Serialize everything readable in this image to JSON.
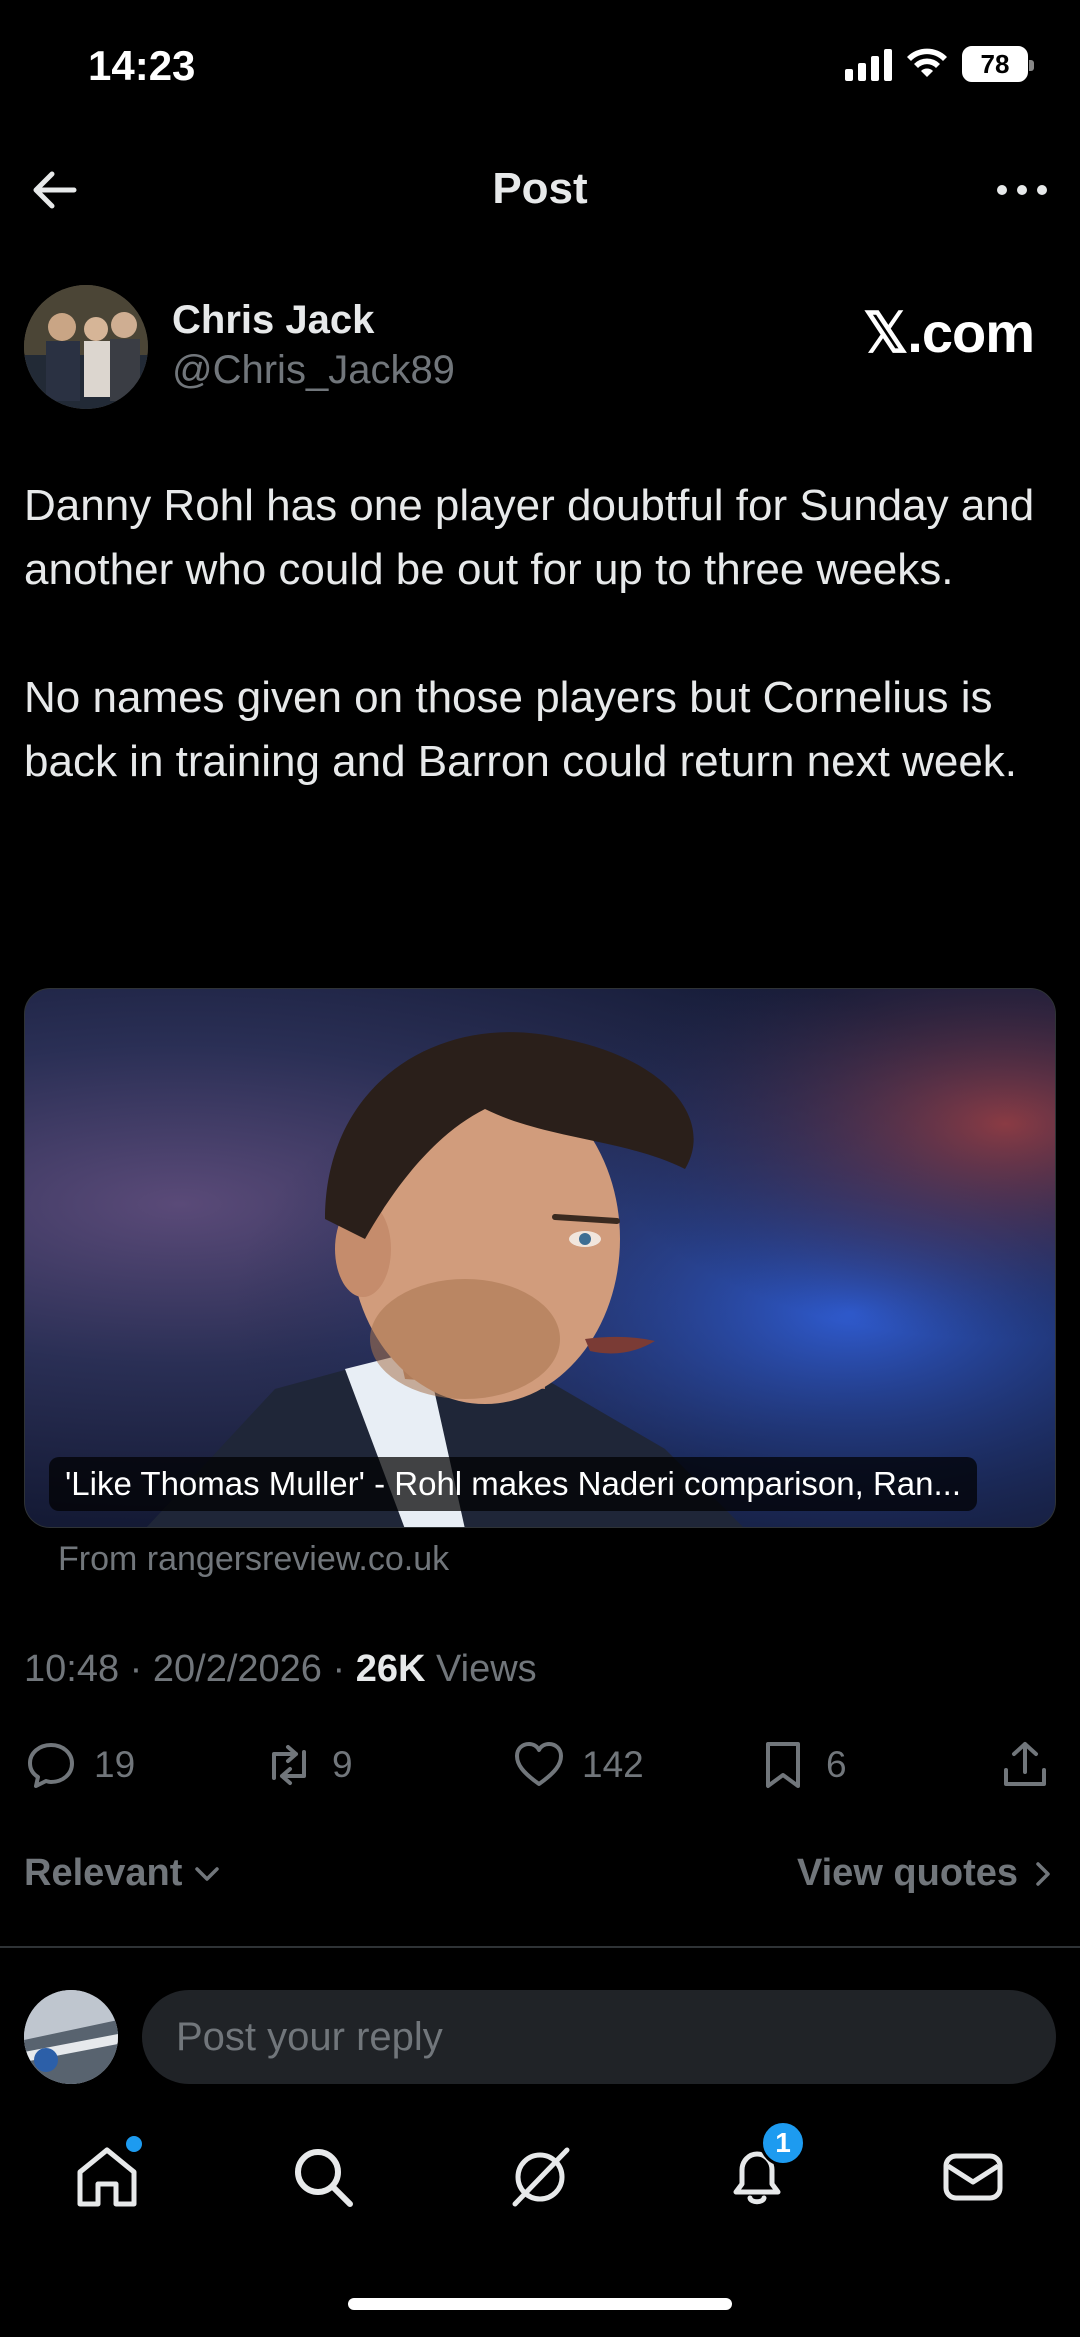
{
  "status_bar": {
    "time": "14:23",
    "battery": "78"
  },
  "nav": {
    "title": "Post"
  },
  "author": {
    "name": "Chris Jack",
    "handle": "@Chris_Jack89",
    "source_logo": "𝕏.com"
  },
  "post": {
    "paragraphs": [
      "Danny Rohl has one player doubtful for Sunday and another who could be out for up to three weeks.",
      "No names given on those players but Cornelius is back in training and Barron could return next week."
    ]
  },
  "card": {
    "caption": "'Like Thomas Muller' - Rohl makes Naderi comparison, Ran...",
    "source": "From rangersreview.co.uk"
  },
  "meta": {
    "time": "10:48",
    "date": "20/2/2026",
    "views_count": "26K",
    "views_label": "Views",
    "separator": "·"
  },
  "actions": {
    "replies": "19",
    "reposts": "9",
    "likes": "142",
    "bookmarks": "6"
  },
  "filters": {
    "relevant": "Relevant",
    "view_quotes": "View quotes"
  },
  "reply": {
    "placeholder": "Post your reply"
  },
  "bottom_nav": {
    "notifications_badge": "1"
  },
  "colors": {
    "background": "#000000",
    "text": "#e7e9ea",
    "muted": "#71767b",
    "accent": "#1d9bf0"
  }
}
